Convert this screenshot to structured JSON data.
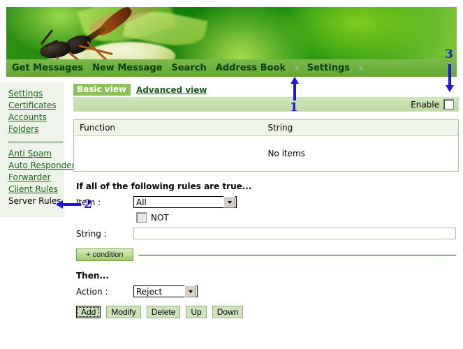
{
  "banner": {
    "alt": "wasp-on-flower-banner"
  },
  "nav": {
    "items": [
      {
        "label": "Get Messages",
        "type": "link"
      },
      {
        "label": "New Message",
        "type": "link"
      },
      {
        "label": "Search",
        "type": "link"
      },
      {
        "label": "Address Book",
        "type": "link"
      },
      {
        "label": "x",
        "type": "separator"
      },
      {
        "label": "Settings",
        "type": "link"
      },
      {
        "label": "x",
        "type": "separator"
      }
    ]
  },
  "sidebar": {
    "group1": [
      {
        "label": "Settings",
        "current": false
      },
      {
        "label": "Certificates",
        "current": false
      },
      {
        "label": "Accounts",
        "current": false
      },
      {
        "label": "Folders",
        "current": false
      }
    ],
    "group2": [
      {
        "label": "Anti Spam",
        "current": false
      },
      {
        "label": "Auto Responder",
        "current": false
      },
      {
        "label": "Forwarder",
        "current": false
      },
      {
        "label": "Client Rules",
        "current": false
      },
      {
        "label": "Server Rules",
        "current": true
      }
    ]
  },
  "tabs": {
    "basic": "Basic view",
    "advanced": "Advanced view",
    "active": "Basic view"
  },
  "enable": {
    "label": "Enable",
    "checked": false
  },
  "table": {
    "columns": [
      "Function",
      "String"
    ],
    "rows": [],
    "empty_message": "No items"
  },
  "conditions": {
    "heading": "If all of the following rules are true...",
    "item_label": "Item :",
    "item_value": "All",
    "item_options": [
      "All"
    ],
    "not_label": "NOT",
    "not_checked": false,
    "string_label": "String :",
    "string_value": "",
    "add_condition_label": "+ condition"
  },
  "then": {
    "heading": "Then...",
    "action_label": "Action :",
    "action_value": "Reject",
    "action_options": [
      "Reject"
    ]
  },
  "buttons": [
    {
      "label": "Add",
      "focused": true
    },
    {
      "label": "Modify",
      "focused": false
    },
    {
      "label": "Delete",
      "focused": false
    },
    {
      "label": "Up",
      "focused": false
    },
    {
      "label": "Down",
      "focused": false
    }
  ],
  "annotations": [
    {
      "number": "1",
      "direction": "up",
      "target": "Settings nav link"
    },
    {
      "number": "2",
      "direction": "left",
      "target": "Server Rules sidebar link"
    },
    {
      "number": "3",
      "direction": "down",
      "target": "Enable checkbox"
    }
  ],
  "colors": {
    "brand_green": "#1d7a0c",
    "nav_green": "#7cb74a",
    "tab_active": "#8cc059",
    "link_green": "#166b10",
    "annotation_blue": "#2210e8",
    "button_green": "#cfe3bd"
  }
}
